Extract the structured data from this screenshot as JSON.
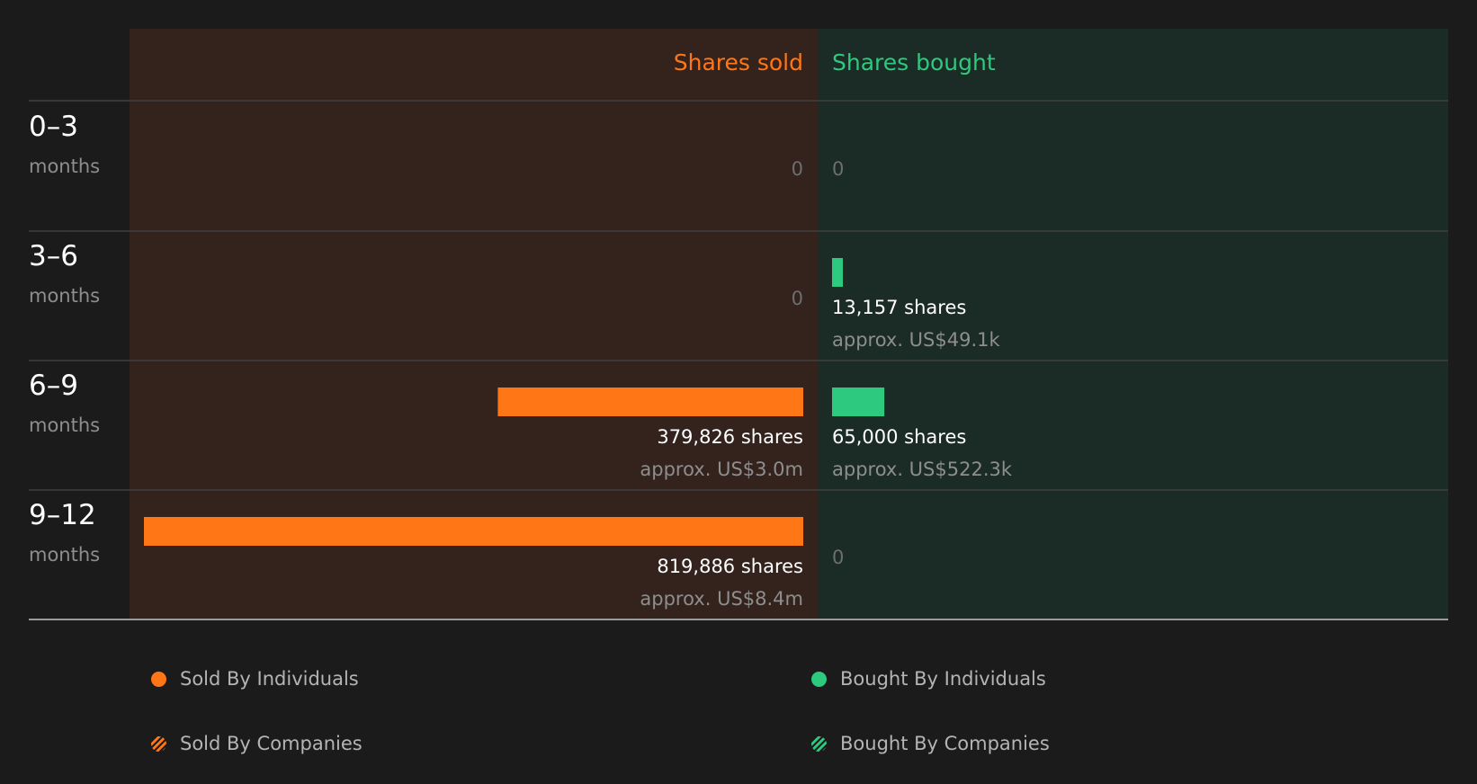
{
  "colors": {
    "background": "#1b1b1b",
    "sold_panel": "#33231c",
    "bought_panel": "#1b2b25",
    "sold": "#ff7617",
    "bought": "#2dc97e",
    "primary_text": "#ffffff",
    "muted_text": "#8e8e8e",
    "zero_text": "#6e6e6e",
    "divider": "#3f3f3f"
  },
  "header": {
    "sold_label": "Shares sold",
    "bought_label": "Shares bought"
  },
  "chart_data": {
    "type": "bar",
    "categories": [
      {
        "range": "0–3",
        "unit": "months"
      },
      {
        "range": "3–6",
        "unit": "months"
      },
      {
        "range": "6–9",
        "unit": "months"
      },
      {
        "range": "9–12",
        "unit": "months"
      }
    ],
    "series": [
      {
        "name": "Shares sold",
        "values": [
          0,
          0,
          379826,
          819886
        ],
        "shares_labels": [
          "0",
          "0",
          "379,826 shares",
          "819,886 shares"
        ],
        "value_labels": [
          "",
          "",
          "approx. US$3.0m",
          "approx. US$8.4m"
        ]
      },
      {
        "name": "Shares bought",
        "values": [
          0,
          13157,
          65000,
          0
        ],
        "shares_labels": [
          "0",
          "13,157 shares",
          "65,000 shares",
          "0"
        ],
        "value_labels": [
          "",
          "approx. US$49.1k",
          "approx. US$522.3k",
          ""
        ]
      }
    ],
    "xlim": [
      0,
      819886
    ]
  },
  "legend": [
    {
      "label": "Sold By Individuals",
      "style": "solid",
      "color": "#ff7617"
    },
    {
      "label": "Bought By Individuals",
      "style": "solid",
      "color": "#2dc97e"
    },
    {
      "label": "Sold By Companies",
      "style": "hatched",
      "color": "#ff7617"
    },
    {
      "label": "Bought By Companies",
      "style": "hatched",
      "color": "#2dc97e"
    }
  ]
}
